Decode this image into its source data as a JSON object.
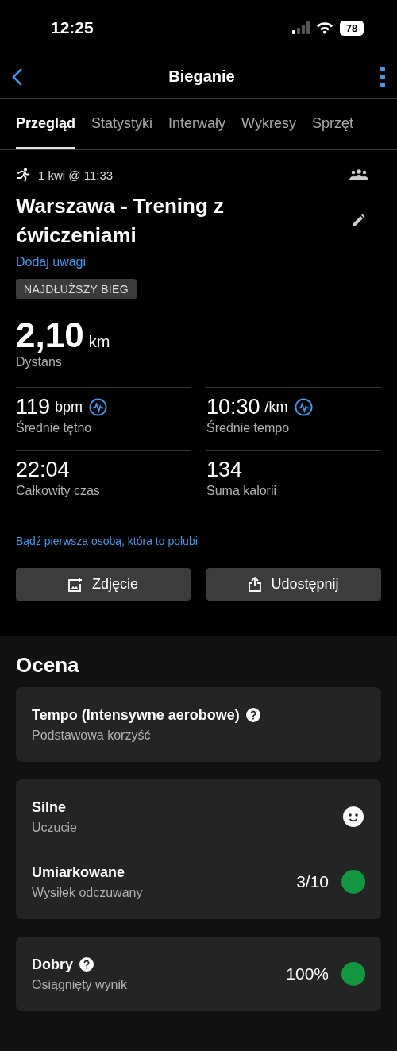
{
  "status_bar": {
    "time": "12:25",
    "battery": "78"
  },
  "nav": {
    "title": "Bieganie"
  },
  "tabs": [
    {
      "label": "Przegląd",
      "selected": true
    },
    {
      "label": "Statystyki",
      "selected": false
    },
    {
      "label": "Interwały",
      "selected": false
    },
    {
      "label": "Wykresy",
      "selected": false
    },
    {
      "label": "Sprzęt",
      "selected": false
    }
  ],
  "activity": {
    "date": "1 kwi @ 11:33",
    "title": "Warszawa - Trening z ćwiczeniami",
    "notes_link": "Dodaj uwagi",
    "badge": "NAJDŁUŻSZY BIEG",
    "distance": {
      "value": "2,10",
      "unit": "km",
      "label": "Dystans"
    },
    "stats": [
      {
        "value": "119",
        "unit": "bpm",
        "label": "Średnie tętno",
        "chart_link": true
      },
      {
        "value": "10:30",
        "unit": "/km",
        "label": "Średnie tempo",
        "chart_link": true
      },
      {
        "value": "22:04",
        "label": "Całkowity czas",
        "chart_link": false
      },
      {
        "value": "134",
        "label": "Suma kalorii",
        "chart_link": false
      }
    ],
    "like_link": "Bądź pierwszą osobą, która to polubi",
    "buttons": [
      {
        "kind": "photo",
        "label": "Zdjęcie"
      },
      {
        "kind": "share",
        "label": "Udostępnij"
      }
    ]
  },
  "rating": {
    "heading": "Ocena",
    "cards": [
      {
        "rows": [
          {
            "kind": "plain",
            "title": "Tempo (Intensywne aerobowe)",
            "help": true,
            "subtitle": "Podstawowa korzyść"
          }
        ]
      },
      {
        "rows": [
          {
            "kind": "smiley",
            "title": "Silne",
            "help": false,
            "subtitle": "Uczucie"
          },
          {
            "kind": "dot",
            "title": "Umiarkowane",
            "help": false,
            "subtitle": "Wysiłek odczuwany",
            "value": "3/10",
            "color": "#119740"
          }
        ]
      },
      {
        "rows": [
          {
            "kind": "dot",
            "title": "Dobry",
            "help": true,
            "subtitle": "Osiągnięty wynik",
            "value": "100%",
            "color": "#119740"
          }
        ]
      }
    ]
  }
}
